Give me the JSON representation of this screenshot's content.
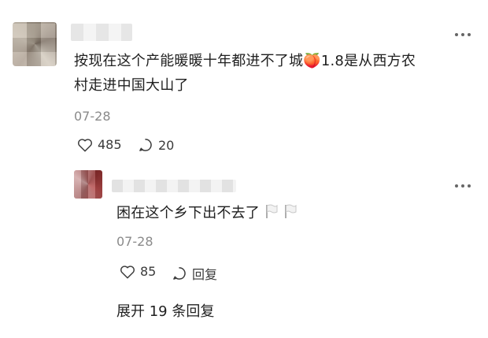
{
  "comment": {
    "text_line1": "按现在这个产能暖暖十年都进不了城",
    "text_emoji": "🍑",
    "text_line1_tail": "1.8是从西方农",
    "text_line2": "村走进中国大山了",
    "date": "07-28",
    "likes": "485",
    "replies_count": "20"
  },
  "reply": {
    "text": "困在这个乡下出不去了",
    "emoji_1": "🏳",
    "emoji_2": "🏳",
    "date": "07-28",
    "likes": "85",
    "reply_label": "回复"
  },
  "expand": {
    "label": "展开 19 条回复"
  },
  "icons": {
    "like": "heart-outline-icon",
    "comment": "speech-bubble-icon",
    "more": "more-dots-icon",
    "flag": "white-flag-icon"
  },
  "colors": {
    "text": "#1f1f1f",
    "muted": "#8a8a8a",
    "icon": "#3a3a3a"
  }
}
